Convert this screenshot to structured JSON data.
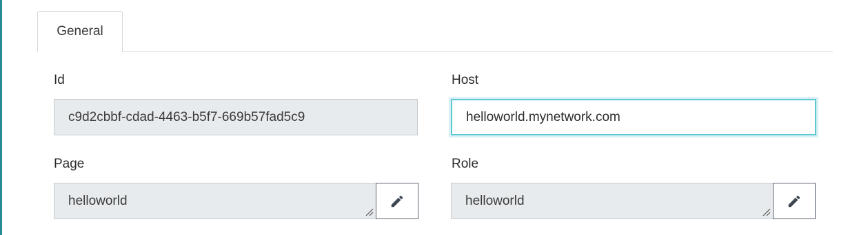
{
  "tabs": {
    "general_label": "General"
  },
  "fields": {
    "id": {
      "label": "Id",
      "value": "c9d2cbbf-cdad-4463-b5f7-669b57fad5c9"
    },
    "host": {
      "label": "Host",
      "value": "helloworld.mynetwork.com"
    },
    "page": {
      "label": "Page",
      "value": "helloworld"
    },
    "role": {
      "label": "Role",
      "value": "helloworld"
    }
  },
  "icons": {
    "edit": "pencil-icon",
    "resize": "resize-grip-icon"
  },
  "colors": {
    "accent": "#2a8a96",
    "focus_border": "#5bc8d4",
    "readonly_bg": "#e8ebed"
  }
}
